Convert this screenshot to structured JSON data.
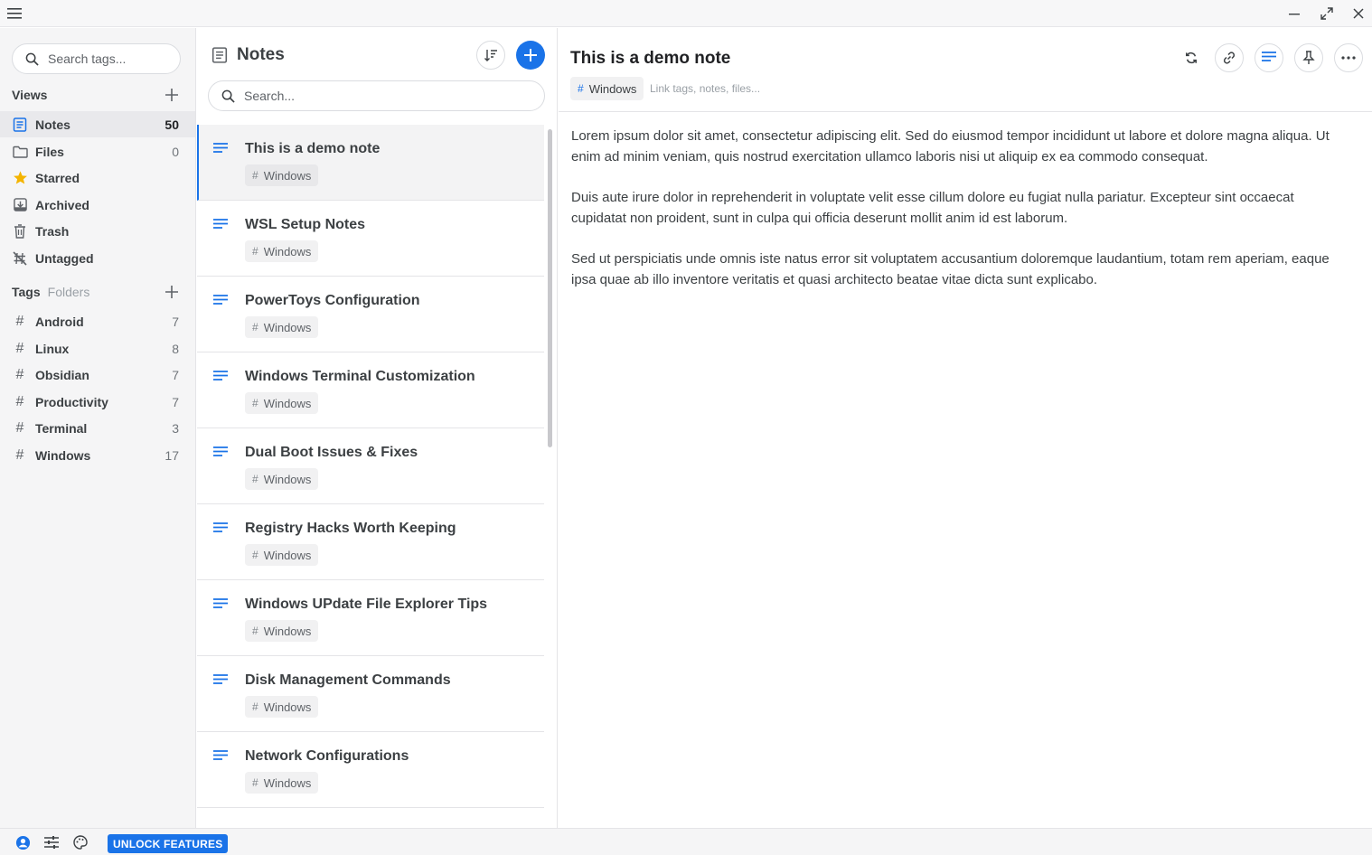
{
  "sidebar": {
    "search_placeholder": "Search tags...",
    "views_label": "Views",
    "views": [
      {
        "label": "Notes",
        "count": "50",
        "icon": "notes-icon"
      },
      {
        "label": "Files",
        "count": "0",
        "icon": "folder-icon"
      },
      {
        "label": "Starred",
        "count": "",
        "icon": "star-icon"
      },
      {
        "label": "Archived",
        "count": "",
        "icon": "archive-icon"
      },
      {
        "label": "Trash",
        "count": "",
        "icon": "trash-icon"
      },
      {
        "label": "Untagged",
        "count": "",
        "icon": "untagged-icon"
      }
    ],
    "tags_label": "Tags",
    "folders_label": "Folders",
    "tags": [
      {
        "label": "Android",
        "count": "7"
      },
      {
        "label": "Linux",
        "count": "8"
      },
      {
        "label": "Obsidian",
        "count": "7"
      },
      {
        "label": "Productivity",
        "count": "7"
      },
      {
        "label": "Terminal",
        "count": "3"
      },
      {
        "label": "Windows",
        "count": "17"
      }
    ]
  },
  "notes_list": {
    "title": "Notes",
    "search_placeholder": "Search...",
    "items": [
      {
        "title": "This is a demo note",
        "tag": "Windows"
      },
      {
        "title": "WSL Setup Notes",
        "tag": "Windows"
      },
      {
        "title": "PowerToys Configuration",
        "tag": "Windows"
      },
      {
        "title": "Windows Terminal Customization",
        "tag": "Windows"
      },
      {
        "title": "Dual Boot Issues & Fixes",
        "tag": "Windows"
      },
      {
        "title": "Registry Hacks Worth Keeping",
        "tag": "Windows"
      },
      {
        "title": "Windows UPdate File Explorer Tips",
        "tag": "Windows"
      },
      {
        "title": "Disk Management Commands",
        "tag": "Windows"
      },
      {
        "title": "Network Configurations",
        "tag": "Windows"
      }
    ]
  },
  "editor": {
    "title": "This is a demo note",
    "tag": "Windows",
    "link_placeholder": "Link tags, notes, files...",
    "paragraphs": [
      "Lorem ipsum dolor sit amet, consectetur adipiscing elit. Sed do eiusmod tempor incididunt ut labore et dolore magna aliqua. Ut enim ad minim veniam, quis nostrud exercitation ullamco laboris nisi ut aliquip ex ea commodo consequat.",
      "Duis aute irure dolor in reprehenderit in voluptate velit esse cillum dolore eu fugiat nulla pariatur. Excepteur sint occaecat cupidatat non proident, sunt in culpa qui officia deserunt mollit anim id est laborum.",
      "Sed ut perspiciatis unde omnis iste natus error sit voluptatem accusantium doloremque laudantium, totam rem aperiam, eaque ipsa quae ab illo inventore veritatis et quasi architecto beatae vitae dicta sunt explicabo."
    ]
  },
  "footer": {
    "unlock_label": "UNLOCK FEATURES"
  },
  "colors": {
    "accent": "#1a73e8",
    "star": "#f4b400",
    "spell": "#d93025"
  }
}
